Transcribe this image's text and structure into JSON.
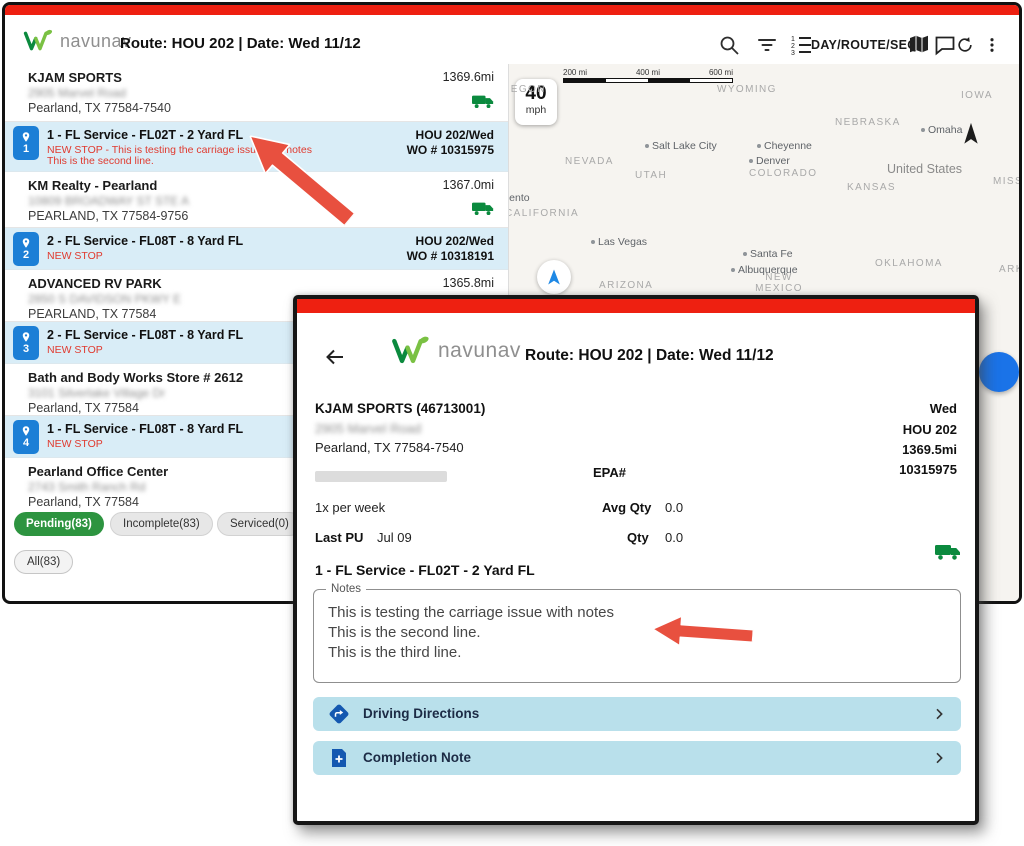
{
  "colors": {
    "top_bar_red": "#ee2011",
    "service_row_blue": "#d9edf7",
    "badge_blue": "#1c7fd6",
    "note_red": "#e03a2f",
    "pending_green": "#2d9440",
    "truck_green": "#0b8a3e",
    "action_button_teal": "#b9e0eb",
    "action_icon_blue": "#1458b0",
    "fab_blue": "#1a73e8",
    "annotation_arrow_red": "#e8503f"
  },
  "header": {
    "brand": "navunav",
    "route_title": "Route: HOU 202 | Date: Wed 11/12",
    "day_route_seq_label": "DAY/ROUTE/SEQ"
  },
  "list": {
    "stops": [
      {
        "name": "KJAM SPORTS",
        "address": "2905 Marvel Road",
        "city": "Pearland, TX 77584-7540",
        "distance": "1369.6mi"
      },
      {
        "name": "KM Realty - Pearland",
        "address": "10809 BROADWAY ST STE A",
        "city": "PEARLAND, TX 77584-9756",
        "distance": "1367.0mi"
      },
      {
        "name": "ADVANCED RV PARK",
        "address": "2850 S DAVIDSON PKWY E",
        "city": "PEARLAND, TX 77584",
        "distance": "1365.8mi"
      },
      {
        "name": "Bath and Body Works Store # 2612",
        "address": "3101 Silverlake Village Dr",
        "city": "Pearland, TX 77584",
        "distance": ""
      },
      {
        "name": "Pearland Office Center",
        "address": "2743 Smith Ranch Rd",
        "city": "Pearland, TX 77584",
        "distance": ""
      }
    ],
    "services": [
      {
        "seq": "1",
        "title": "1 - FL Service - FL02T - 2 Yard FL",
        "note1": "NEW STOP - This is testing the carriage issue with notes",
        "note2": "This is the second line.",
        "route": "HOU 202/Wed",
        "wo": "WO # 10315975"
      },
      {
        "seq": "2",
        "title": "2 - FL Service - FL08T - 8 Yard FL",
        "note1": "NEW STOP",
        "note2": "",
        "route": "HOU 202/Wed",
        "wo": "WO # 10318191"
      },
      {
        "seq": "3",
        "title": "2 - FL Service - FL08T - 8 Yard FL",
        "note1": "NEW STOP",
        "note2": "",
        "route": "",
        "wo": ""
      },
      {
        "seq": "4",
        "title": "1 - FL Service - FL08T - 8 Yard FL",
        "note1": "NEW STOP",
        "note2": "",
        "route": "",
        "wo": ""
      }
    ],
    "filters": {
      "pending": "Pending(83)",
      "incomplete": "Incomplete(83)",
      "serviced": "Serviced(0)",
      "all": "All(83)"
    }
  },
  "map": {
    "speed_value": "40",
    "speed_unit": "mph",
    "scale_labels": [
      "200 mi",
      "400 mi",
      "600 mi"
    ],
    "country": "United States",
    "states": [
      "OREGON",
      "WYOMING",
      "NEBRASKA",
      "IOWA",
      "NEVADA",
      "UTAH",
      "COLORADO",
      "KANSAS",
      "MISSOURI",
      "CALIFORNIA",
      "ARIZONA",
      "NEW MEXICO",
      "OKLAHOMA",
      "ARKANSAS"
    ],
    "cities": [
      "Sacramento",
      "Salt Lake City",
      "Cheyenne",
      "Omaha",
      "Denver",
      "Las Vegas",
      "Santa Fe",
      "Albuquerque"
    ]
  },
  "detail": {
    "brand": "navunav",
    "route_title": "Route: HOU 202 | Date: Wed 11/12",
    "customer": "KJAM SPORTS (46713001)",
    "address": "2905 Marvel Road",
    "city": "Pearland, TX 77584-7540",
    "day": "Wed",
    "route": "HOU 202",
    "distance": "1369.5mi",
    "order_number": "10315975",
    "epa_label": "EPA#",
    "frequency": "1x per week",
    "avg_qty_label": "Avg Qty",
    "avg_qty_value": "0.0",
    "last_pu_label": "Last PU",
    "last_pu_value": "Jul 09",
    "qty_label": "Qty",
    "qty_value": "0.0",
    "service_title": "1 - FL Service - FL02T - 2 Yard FL",
    "notes_label": "Notes",
    "notes_line1": "This is testing the carriage issue with notes",
    "notes_line2": "This is the second line.",
    "notes_line3": "This is the third line.",
    "driving_directions_label": "Driving Directions",
    "completion_note_label": "Completion Note"
  }
}
